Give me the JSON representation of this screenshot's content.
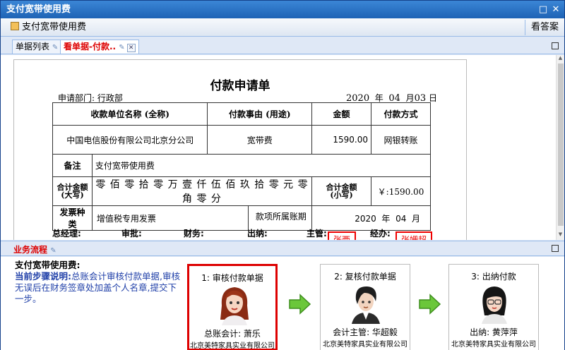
{
  "window": {
    "title": "支付宽带使用费",
    "restore_symbol": "□",
    "close_symbol": "✕"
  },
  "toolbar": {
    "app_label": "支付宽带使用费",
    "answer_button": "看答案"
  },
  "tabs": [
    {
      "label": "单据列表"
    },
    {
      "label": "看单据-付款.."
    }
  ],
  "document": {
    "title": "付款申请单",
    "department": "申请部门: 行政部",
    "date": {
      "year": "2020",
      "year_unit": "年",
      "month": "04",
      "month_unit": "月",
      "day": "03",
      "day_unit": "日"
    },
    "headers": {
      "payee": "收款单位名称 (全称)",
      "reason": "付款事由 (用途)",
      "amount": "金额",
      "method": "付款方式"
    },
    "row": {
      "payee": "中国电信股份有限公司北京分公司",
      "reason": "宽带费",
      "amount": "1590.00",
      "method": "网银转账"
    },
    "remark_label": "备注",
    "remark": "支付宽带使用费",
    "total_cn_label": "合计金额",
    "total_cn_sub": "(大写)",
    "total_cn": "零 佰 零 拾 零 万 壹 仟 伍 佰 玖 拾 零 元 零 角 零 分",
    "total_num_label": "合计金额",
    "total_num_sub": "(小写)",
    "total_num": "￥:1590.00",
    "invoice_label": "发票种类",
    "invoice": "增值税专用发票",
    "period_label": "款项所属账期",
    "period": {
      "year": "2020",
      "year_unit": "年",
      "month": "04",
      "month_unit": "月"
    },
    "signatures": {
      "gm": "总经理:",
      "approve": "审批:",
      "finance": "财务:",
      "cashier": "出纳:",
      "supervisor": "主管:",
      "handler": "经办:"
    },
    "stamps": {
      "supervisor": "张西",
      "handler": "张姗超"
    }
  },
  "flow_panel": {
    "title": "业务流程"
  },
  "flow": {
    "heading": "支付宽带使用费:",
    "step_label": "当前步骤说明:",
    "description": "总账会计审核付款单据,审核无误后在财务签章处加盖个人名章,提交下一步。",
    "steps": [
      {
        "title": "1: 审核付款单据",
        "role": "总账会计: 萧乐",
        "company": "北京美特家具实业有限公司",
        "active": true
      },
      {
        "title": "2: 复核付款单据",
        "role": "会计主管: 华超毅",
        "company": "北京美特家具实业有限公司",
        "active": false
      },
      {
        "title": "3: 出纳付款",
        "role": "出纳: 黄萍萍",
        "company": "北京美特家具实业有限公司",
        "active": false
      }
    ]
  },
  "colors": {
    "titlebar": "#1e63b5",
    "active_tab": "#dd0000",
    "stamp": "#e00000",
    "arrow": "#6bc73a",
    "desc_text": "#1f3fa8"
  }
}
